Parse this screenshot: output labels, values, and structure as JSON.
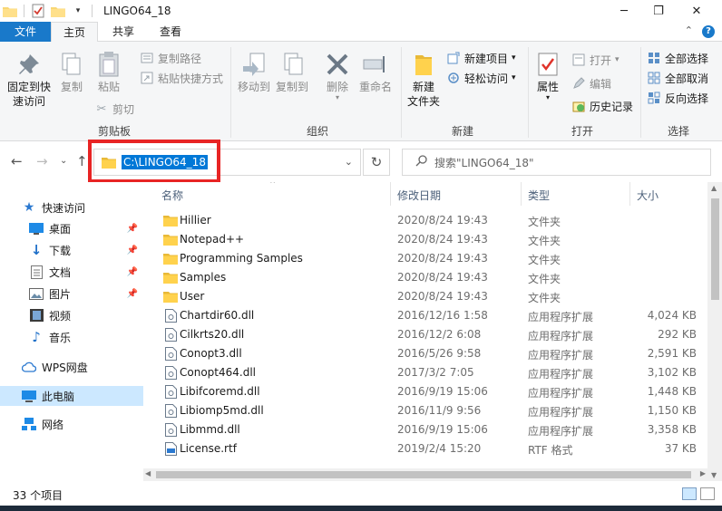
{
  "window": {
    "title": "LINGO64_18",
    "controls": {
      "minimize": "─",
      "maximize": "❐",
      "close": "✕"
    }
  },
  "tabs": {
    "file": "文件",
    "home": "主页",
    "share": "共享",
    "view": "查看"
  },
  "ribbon": {
    "clipboard": {
      "pin": "固定到快速访问",
      "pin_l1": "固定到快",
      "pin_l2": "速访问",
      "copy": "复制",
      "paste": "粘贴",
      "copy_path": "复制路径",
      "paste_shortcut": "粘贴快捷方式",
      "cut": "剪切",
      "label": "剪贴板"
    },
    "organize": {
      "move_to": "移动到",
      "copy_to": "复制到",
      "delete": "删除",
      "rename": "重命名",
      "label": "组织"
    },
    "new": {
      "new_folder_l1": "新建",
      "new_folder_l2": "文件夹",
      "new_item": "新建项目",
      "easy_access": "轻松访问",
      "label": "新建"
    },
    "open": {
      "properties": "属性",
      "open": "打开",
      "edit": "编辑",
      "history": "历史记录",
      "label": "打开"
    },
    "select": {
      "select_all": "全部选择",
      "select_none": "全部取消",
      "invert": "反向选择",
      "label": "选择"
    }
  },
  "address": {
    "path": "C:\\LINGO64_18"
  },
  "search": {
    "placeholder": "搜索\"LINGO64_18\""
  },
  "nav": {
    "quick_access": "快速访问",
    "desktop": "桌面",
    "downloads": "下载",
    "documents": "文档",
    "pictures": "图片",
    "videos": "视频",
    "music": "音乐",
    "wps": "WPS网盘",
    "this_pc": "此电脑",
    "network": "网络"
  },
  "columns": {
    "name": "名称",
    "date": "修改日期",
    "type": "类型",
    "size": "大小"
  },
  "files": [
    {
      "name": "Hillier",
      "date": "2020/8/24 19:43",
      "type": "文件夹",
      "size": "",
      "icon": "folder-icon"
    },
    {
      "name": "Notepad++",
      "date": "2020/8/24 19:43",
      "type": "文件夹",
      "size": "",
      "icon": "folder-icon"
    },
    {
      "name": "Programming Samples",
      "date": "2020/8/24 19:43",
      "type": "文件夹",
      "size": "",
      "icon": "folder-icon"
    },
    {
      "name": "Samples",
      "date": "2020/8/24 19:43",
      "type": "文件夹",
      "size": "",
      "icon": "folder-icon"
    },
    {
      "name": "User",
      "date": "2020/8/24 19:43",
      "type": "文件夹",
      "size": "",
      "icon": "folder-icon"
    },
    {
      "name": "Chartdir60.dll",
      "date": "2016/12/16 1:58",
      "type": "应用程序扩展",
      "size": "4,024 KB",
      "icon": "dll-icon"
    },
    {
      "name": "Cilkrts20.dll",
      "date": "2016/12/2 6:08",
      "type": "应用程序扩展",
      "size": "292 KB",
      "icon": "dll-icon"
    },
    {
      "name": "Conopt3.dll",
      "date": "2016/5/26 9:58",
      "type": "应用程序扩展",
      "size": "2,591 KB",
      "icon": "dll-icon"
    },
    {
      "name": "Conopt464.dll",
      "date": "2017/3/2 7:05",
      "type": "应用程序扩展",
      "size": "3,102 KB",
      "icon": "dll-icon"
    },
    {
      "name": "Libifcoremd.dll",
      "date": "2016/9/19 15:06",
      "type": "应用程序扩展",
      "size": "1,448 KB",
      "icon": "dll-icon"
    },
    {
      "name": "Libiomp5md.dll",
      "date": "2016/11/9 9:56",
      "type": "应用程序扩展",
      "size": "1,150 KB",
      "icon": "dll-icon"
    },
    {
      "name": "Libmmd.dll",
      "date": "2016/9/19 15:06",
      "type": "应用程序扩展",
      "size": "3,358 KB",
      "icon": "dll-icon"
    },
    {
      "name": "License.rtf",
      "date": "2019/2/4 15:20",
      "type": "RTF 格式",
      "size": "37 KB",
      "icon": "rtf-icon"
    }
  ],
  "status": {
    "count": "33 个项目"
  }
}
